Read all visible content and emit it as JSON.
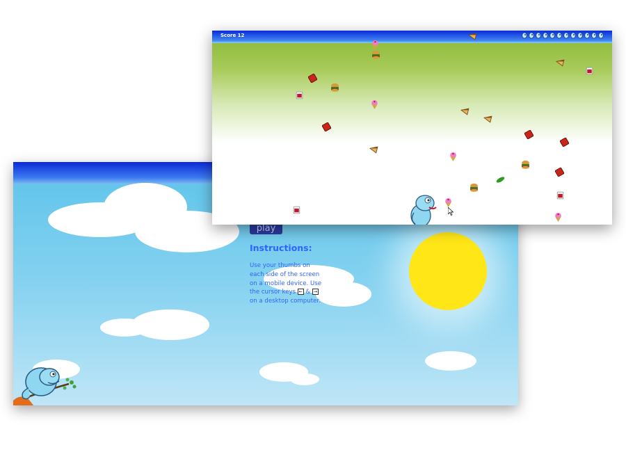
{
  "menu": {
    "play_label": "play",
    "instructions_title": "Instructions:",
    "instructions_lines": [
      "Use your thumbs on",
      "each side of the screen",
      "on a mobile device. Use",
      "the cursor keys",
      "on a desktop computer."
    ],
    "instructions_and": "&",
    "key_left": "←",
    "key_right": "→"
  },
  "game": {
    "score_text": "Score 12",
    "lives_remaining": 12,
    "life_icon": "chameleon-head-icon",
    "falling_items": [
      "burger-icon",
      "ice-cream-icon",
      "pie-slice-icon",
      "jam-jar-icon",
      "book-icon",
      "pickle-icon"
    ]
  },
  "colors": {
    "hud_blue": "#0a2adb",
    "sky_blue": "#5cc3ea",
    "sun_yellow": "#ffe617",
    "grass_green": "#87b733",
    "instructions_blue": "#2f63ff"
  }
}
